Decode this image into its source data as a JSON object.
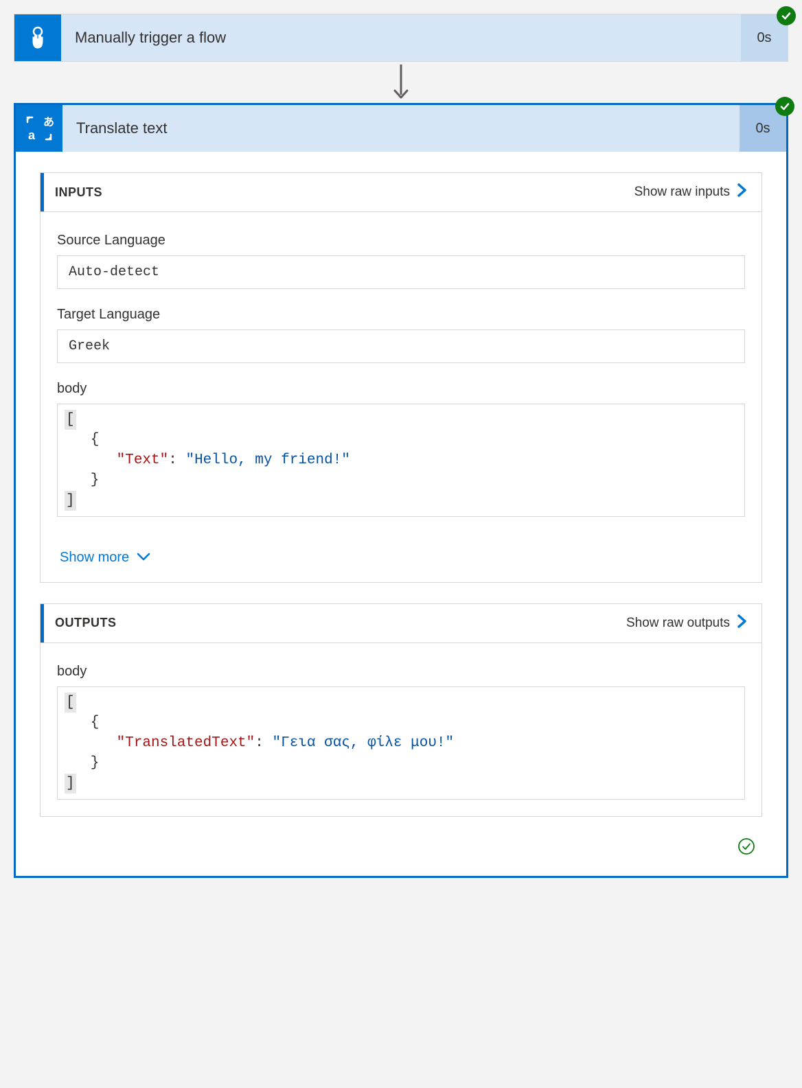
{
  "actions": {
    "trigger": {
      "title": "Manually trigger a flow",
      "duration": "0s"
    },
    "translate": {
      "title": "Translate text",
      "duration": "0s"
    }
  },
  "inputs": {
    "section_title": "INPUTS",
    "show_raw_label": "Show raw inputs",
    "fields": {
      "source_language_label": "Source Language",
      "source_language_value": "Auto-detect",
      "target_language_label": "Target Language",
      "target_language_value": "Greek",
      "body_label": "body"
    },
    "body_json": {
      "key": "\"Text\"",
      "value": "\"Hello, my friend!\""
    },
    "show_more_label": "Show more"
  },
  "outputs": {
    "section_title": "OUTPUTS",
    "show_raw_label": "Show raw outputs",
    "body_label": "body",
    "body_json": {
      "key": "\"TranslatedText\"",
      "value": "\"Γεια σας, φίλε μου!\""
    }
  }
}
